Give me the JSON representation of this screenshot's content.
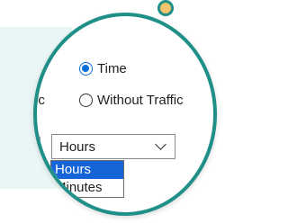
{
  "options": {
    "time_label": "Time",
    "time_selected": true,
    "without_traffic_label": "Without Traffic",
    "without_traffic_selected": false,
    "clipped_label_fragment": "ic"
  },
  "unit_select": {
    "value": "Hours",
    "items": [
      "Hours",
      "Minutes"
    ],
    "highlighted_index": 0
  },
  "colors": {
    "lens_border": "#1f8f87",
    "pin_fill": "#f2c46b",
    "radio_accent": "#0b6fd6",
    "highlight": "#1565d8",
    "background_panel": "#eaf6f5"
  }
}
